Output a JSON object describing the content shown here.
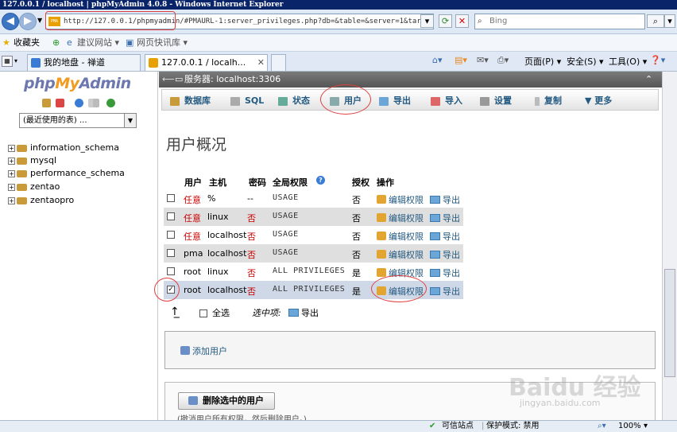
{
  "window": {
    "title": "127.0.0.1 / localhost | phpMyAdmin 4.0.8 - Windows Internet Explorer"
  },
  "browser": {
    "address": "http://127.0.0.1/phpmyadmin/#PMAURL-1:server_privileges.php?db=&table=&server=1&target=&to",
    "search_placeholder": "Bing",
    "favorites_label": "收藏夹",
    "fav_suggested": "建议网站 ▾",
    "fav_webslices": "网页快讯库 ▾",
    "tabs": [
      {
        "label": "我的地盘 - 禅道"
      },
      {
        "label": "127.0.0.1 / localh..."
      }
    ],
    "commands": {
      "page": "页面(P) ▾",
      "safety": "安全(S) ▾",
      "tools": "工具(O) ▾",
      "help": "❓▾"
    }
  },
  "sidebar": {
    "logo": {
      "php": "php",
      "my": "My",
      "admin": "Admin"
    },
    "recent_select": "(最近使用的表) ...",
    "databases": [
      "information_schema",
      "mysql",
      "performance_schema",
      "zentao",
      "zentaopro"
    ]
  },
  "server_bar": {
    "label": "服务器: localhost:3306"
  },
  "main_tabs": [
    "数据库",
    "SQL",
    "状态",
    "用户",
    "导出",
    "导入",
    "设置",
    "复制",
    "更多"
  ],
  "page_title": "用户概况",
  "users_table": {
    "headers": {
      "user": "用户",
      "host": "主机",
      "password": "密码",
      "global_priv": "全局权限",
      "grant": "授权",
      "action": "操作"
    },
    "rows": [
      {
        "user": "任意",
        "host": "%",
        "password": "--",
        "priv": "USAGE",
        "grant": "否",
        "edit": "编辑权限",
        "export": "导出",
        "checked": ""
      },
      {
        "user": "任意",
        "host": "linux",
        "password": "否",
        "priv": "USAGE",
        "grant": "否",
        "edit": "编辑权限",
        "export": "导出",
        "checked": ""
      },
      {
        "user": "任意",
        "host": "localhost",
        "password": "否",
        "priv": "USAGE",
        "grant": "否",
        "edit": "编辑权限",
        "export": "导出",
        "checked": ""
      },
      {
        "user": "pma",
        "host": "localhost",
        "password": "否",
        "priv": "USAGE",
        "grant": "否",
        "edit": "编辑权限",
        "export": "导出",
        "checked": ""
      },
      {
        "user": "root",
        "host": "linux",
        "password": "否",
        "priv": "ALL PRIVILEGES",
        "grant": "是",
        "edit": "编辑权限",
        "export": "导出",
        "checked": ""
      },
      {
        "user": "root",
        "host": "localhost",
        "password": "否",
        "priv": "ALL PRIVILEGES",
        "grant": "是",
        "edit": "编辑权限",
        "export": "导出",
        "checked": "✓"
      }
    ]
  },
  "bulk": {
    "select_all": "全选",
    "with_selected": "选中项:",
    "export": "导出"
  },
  "add_user": "添加用户",
  "delete_selected": "删除选中的用户",
  "delete_note": "(撤消用户所有权限，然后删除用户。)",
  "statusbar": {
    "trusted": "可信站点",
    "protected_mode": "保护模式: 禁用",
    "zoom": "100%"
  },
  "watermark": {
    "main": "Baidu 经验",
    "sub": "jingyan.baidu.com"
  }
}
